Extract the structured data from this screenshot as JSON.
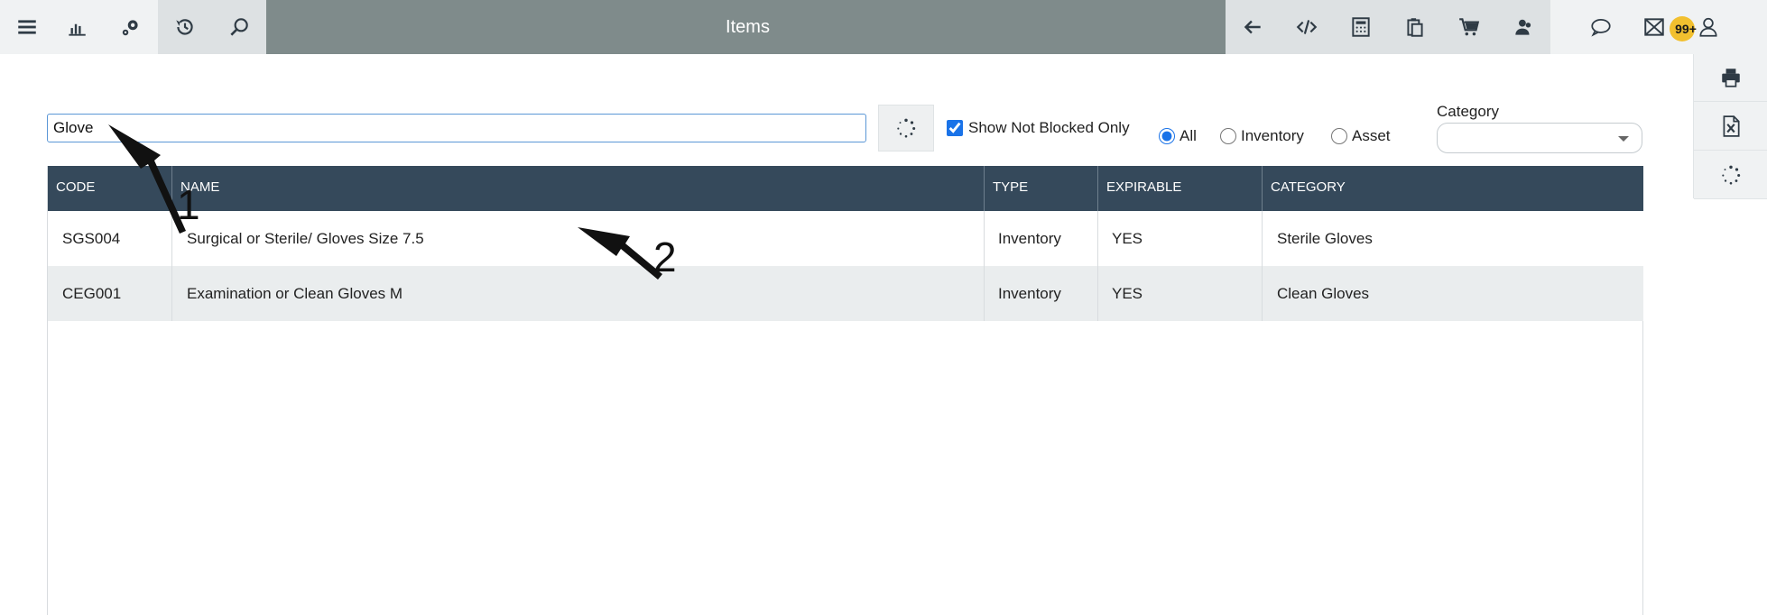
{
  "header": {
    "title": "Items",
    "notification_badge": "99+",
    "left_icons": [
      "menu-icon",
      "bar-chart-icon",
      "gear-icon",
      "history-icon",
      "search-icon"
    ],
    "right_icons": [
      "back-arrow-icon",
      "code-icon",
      "calculator-icon",
      "clipboard-icon",
      "cart-icon",
      "user-group-icon",
      "chat-icon",
      "mail-icon",
      "user-icon"
    ]
  },
  "side_actions": [
    "print-icon",
    "excel-icon",
    "refresh-icon"
  ],
  "filters": {
    "search_value": "Glove",
    "show_not_blocked_label": "Show Not Blocked Only",
    "show_not_blocked_checked": true,
    "type_options": [
      "All",
      "Inventory",
      "Asset"
    ],
    "type_selected": "All",
    "category_label": "Category",
    "category_value": ""
  },
  "table": {
    "columns": [
      "CODE",
      "NAME",
      "TYPE",
      "EXPIRABLE",
      "CATEGORY"
    ],
    "rows": [
      {
        "code": "SGS004",
        "name": "Surgical or Sterile/ Gloves Size 7.5",
        "type": "Inventory",
        "expirable": "YES",
        "category": "Sterile Gloves"
      },
      {
        "code": "CEG001",
        "name": "Examination or Clean Gloves M",
        "type": "Inventory",
        "expirable": "YES",
        "category": "Clean Gloves"
      }
    ]
  },
  "annotations": {
    "arrow1": "1",
    "arrow2": "2"
  },
  "colors": {
    "title_bar": "#7f8b8b",
    "table_header": "#35495b",
    "badge": "#f2c02f",
    "search_border": "#5b97d6",
    "alt_row": "#eaedee"
  }
}
